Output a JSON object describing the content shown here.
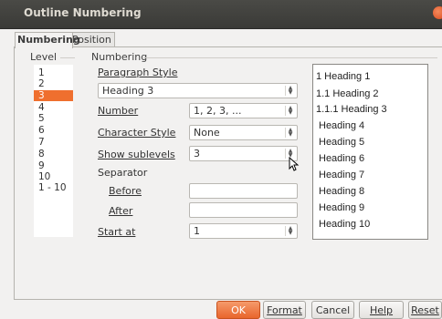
{
  "window": {
    "title": "Outline Numbering"
  },
  "tabs": [
    {
      "label": "Numbering",
      "active": true
    },
    {
      "label": "Position",
      "active": false
    }
  ],
  "level_frame": {
    "label": "Level",
    "items": [
      "1",
      "2",
      "3",
      "4",
      "5",
      "6",
      "7",
      "8",
      "9",
      "10",
      "1 - 10"
    ],
    "selected": "3"
  },
  "numbering_frame": {
    "label": "Numbering",
    "paragraph_style_label": "Paragraph Style",
    "paragraph_style_value": "Heading 3",
    "number_label": "Number",
    "number_value": "1, 2, 3, ...",
    "character_style_label": "Character Style",
    "character_style_value": "None",
    "show_sublevels_label": "Show sublevels",
    "show_sublevels_value": "3",
    "separator_label": "Separator",
    "before_label": "Before",
    "before_value": "",
    "after_label": "After",
    "after_value": "",
    "start_at_label": "Start at",
    "start_at_value": "1"
  },
  "preview": [
    "1 Heading 1",
    "1.1 Heading 2",
    "1.1.1 Heading 3",
    "Heading 4",
    "Heading 5",
    "Heading 6",
    "Heading 7",
    "Heading 8",
    "Heading 9",
    "Heading 10"
  ],
  "buttons": {
    "ok": "OK",
    "format": "Format",
    "cancel": "Cancel",
    "help": "Help",
    "reset": "Reset"
  },
  "colors": {
    "accent": "#ef6f2e",
    "titlebar": "#3c3b37"
  }
}
